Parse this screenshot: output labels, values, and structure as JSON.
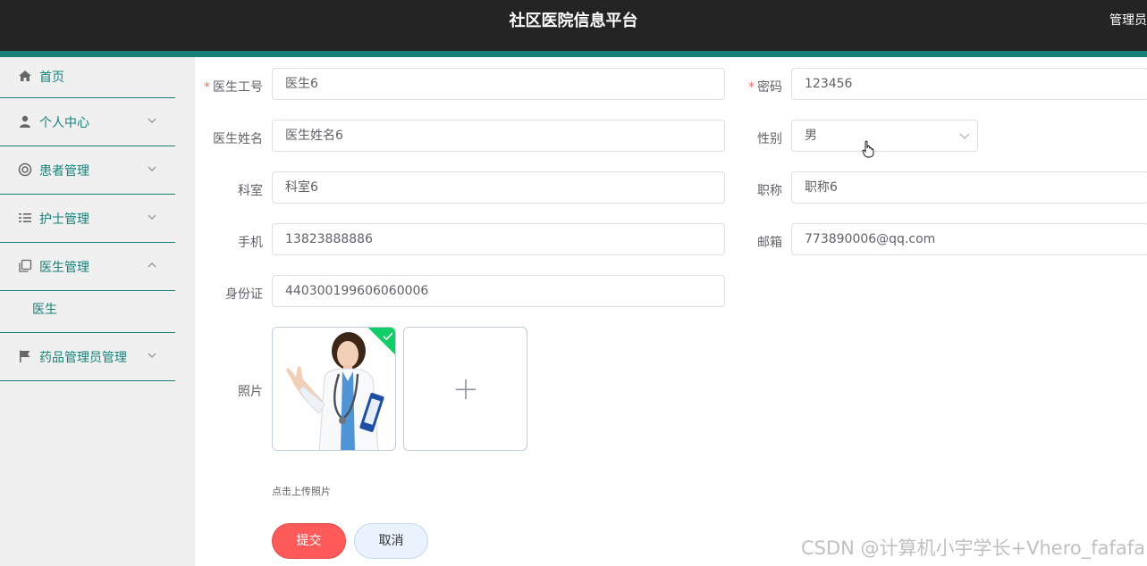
{
  "header": {
    "title": "社区医院信息平台",
    "user_label": "管理员"
  },
  "sidebar": {
    "items": [
      {
        "label": "首页",
        "icon": "home-icon"
      },
      {
        "label": "个人中心",
        "icon": "user-icon"
      },
      {
        "label": "患者管理",
        "icon": "lifebuoy-icon"
      },
      {
        "label": "护士管理",
        "icon": "list-icon"
      },
      {
        "label": "医生管理",
        "icon": "copy-icon",
        "expanded": true,
        "sub_items": [
          "医生"
        ]
      },
      {
        "label": "药品管理员管理",
        "icon": "flag-icon"
      }
    ]
  },
  "form": {
    "doctor_id": {
      "label": "医生工号",
      "value": "医生6",
      "required": true
    },
    "password": {
      "label": "密码",
      "value": "123456",
      "required": true
    },
    "doctor_name": {
      "label": "医生姓名",
      "value": "医生姓名6"
    },
    "gender": {
      "label": "性别",
      "value": "男"
    },
    "department": {
      "label": "科室",
      "value": "科室6"
    },
    "title": {
      "label": "职称",
      "value": "职称6"
    },
    "phone": {
      "label": "手机",
      "value": "13823888886"
    },
    "email": {
      "label": "邮箱",
      "value": "773890006@qq.com"
    },
    "id_card": {
      "label": "身份证",
      "value": "440300199606060006"
    },
    "photo": {
      "label": "照片",
      "hint": "点击上传照片"
    },
    "required_mark": "*"
  },
  "buttons": {
    "submit": "提交",
    "cancel": "取消"
  },
  "watermark": "CSDN @计算机小宇学长+Vhero_fafafa",
  "colors": {
    "header_bg": "#242424",
    "accent": "#178079",
    "submit": "#ff5a5a",
    "success": "#13ce66"
  }
}
